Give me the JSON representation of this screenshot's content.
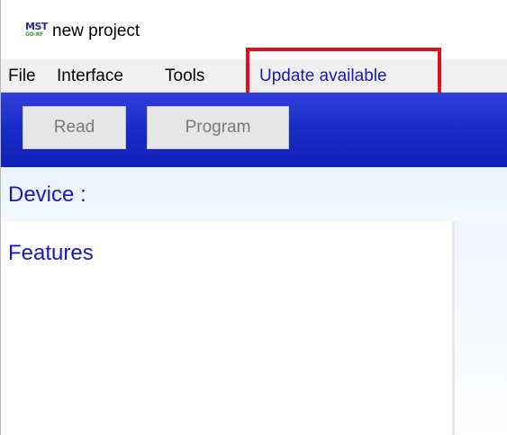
{
  "window": {
    "title": "new project",
    "icon_top": "MST",
    "icon_bottom": "GO-RF"
  },
  "menu": {
    "items": [
      {
        "label": "File"
      },
      {
        "label": "Interface"
      },
      {
        "label": "Tools"
      },
      {
        "label": "Update available"
      }
    ]
  },
  "toolbar": {
    "read_label": "Read",
    "program_label": "Program"
  },
  "device": {
    "label": "Device :"
  },
  "features": {
    "label": "Features"
  },
  "colors": {
    "toolbar_blue": "#1a2ac8",
    "label_blue": "#1a1ab0",
    "highlight_red": "#e0101c"
  }
}
